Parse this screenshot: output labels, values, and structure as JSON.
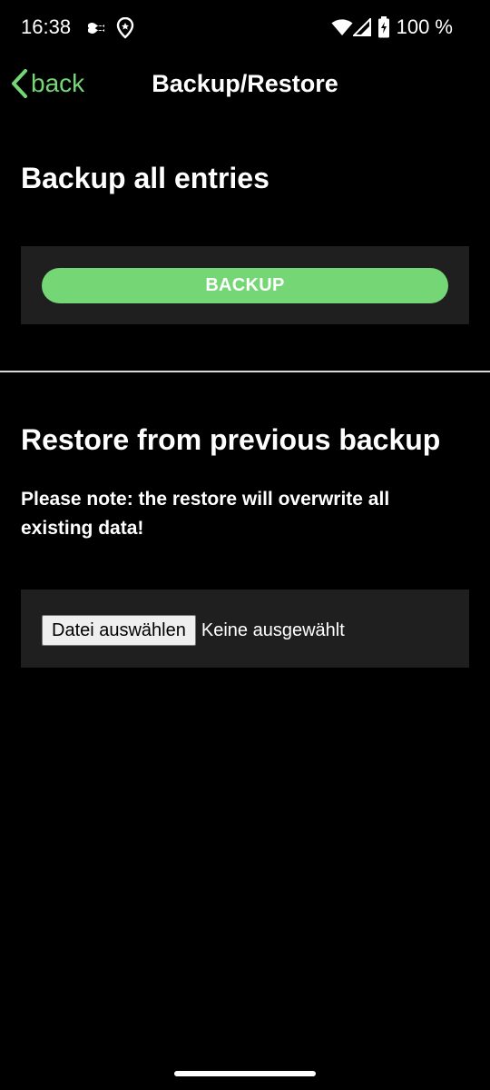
{
  "status_bar": {
    "time": "16:38",
    "battery_percent": "100 %",
    "icons": [
      "data-saver-icon",
      "location-icon",
      "wifi-icon",
      "signal-icon",
      "battery-charging-icon"
    ]
  },
  "nav": {
    "back_label": "back",
    "title": "Backup/Restore"
  },
  "backup_section": {
    "heading": "Backup all entries",
    "button_label": "BACKUP"
  },
  "restore_section": {
    "heading": "Restore from previous backup",
    "note": "Please note: the restore will overwrite all existing data!",
    "file_button_label": "Datei auswählen",
    "file_status": "Keine ausgewählt"
  },
  "colors": {
    "background": "#000000",
    "accent": "#74d675",
    "panel": "#1f1f1f",
    "text": "#ffffff"
  }
}
